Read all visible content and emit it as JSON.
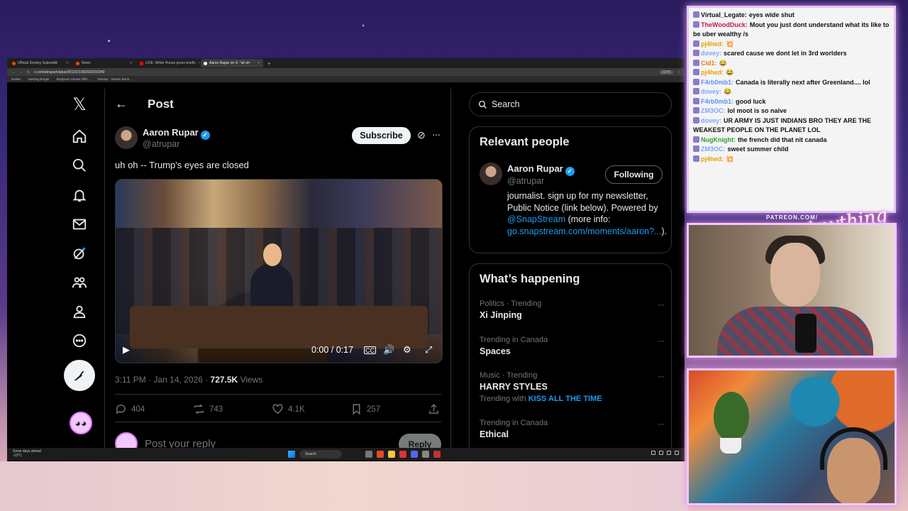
{
  "browser": {
    "tabs": [
      {
        "label": "Official Destiny Subreddit"
      },
      {
        "label": "News"
      },
      {
        "label": "LIVE: White House press briefin"
      },
      {
        "label": "Aaron Rupar on X: \"uh oh"
      }
    ],
    "url": "x.com/atrupar/status/2011531582692016349",
    "zoom": "210%",
    "bookmarks": [
      "Dailies",
      "Nothing Burger",
      "Bodycam Shows Offic...",
      "Destiny - Steven Bonn..."
    ]
  },
  "header": {
    "title": "Post"
  },
  "post": {
    "author_name": "Aaron Rupar",
    "author_handle": "@atrupar",
    "subscribe_label": "Subscribe",
    "text": "uh oh  -- Trump's eyes are closed",
    "video_time": "0:00 / 0:17",
    "timestamp": "3:11 PM · Jan 14, 2026 · ",
    "views_count": "727.5K",
    "views_label": " Views",
    "replies": "404",
    "reposts": "743",
    "likes": "4.1K",
    "bookmarks": "257",
    "reply_placeholder": "Post your reply",
    "reply_button": "Reply"
  },
  "sidebar": {
    "search_placeholder": "Search",
    "relevant_title": "Relevant people",
    "person": {
      "name": "Aaron Rupar",
      "handle": "@atrupar",
      "follow_label": "Following",
      "bio_1": "journalist. sign up for my newsletter, Public Notice (link below). Powered by ",
      "bio_mention": "@SnapStream",
      "bio_2": " (more info: ",
      "bio_link": "go.snapstream.com/moments/aaron?...",
      "bio_3": ")."
    },
    "happening_title": "What’s happening",
    "trends": [
      {
        "category": "Politics · Trending",
        "name": "Xi Jinping"
      },
      {
        "category": "Trending in Canada",
        "name": "Spaces"
      },
      {
        "category": "Music · Trending",
        "name": "HARRY STYLES",
        "sub_prefix": "Trending with ",
        "sub_link": "KISS ALL THE TIME"
      },
      {
        "category": "Trending in Canada",
        "name": "Ethical"
      }
    ]
  },
  "taskbar": {
    "weather_1": "Snow days ahead",
    "weather_2": "-13°C",
    "search": "Search"
  },
  "chat": {
    "messages": [
      {
        "user": "Virtual_Legate:",
        "text": "eyes wide shut",
        "color": "#111111"
      },
      {
        "user": "TheWoodDuck:",
        "text": "Mout you just dont understand what its like to be uber wealthy /s",
        "color": "#c2185b"
      },
      {
        "user": "pj4hed:",
        "text": "💥",
        "color": "#e6a100"
      },
      {
        "user": "dovey:",
        "text": "scared cause we dont let in 3rd worlders",
        "color": "#7fa3ff"
      },
      {
        "user": "Cid1:",
        "text": "😂",
        "color": "#e67e00"
      },
      {
        "user": "pj4hed:",
        "text": "😂",
        "color": "#e6a100"
      },
      {
        "user": "F4rb0mb1:",
        "text": "Canada is literally next after Greenland.... lol",
        "color": "#5c8dff"
      },
      {
        "user": "dovey:",
        "text": "😂",
        "color": "#7fa3ff"
      },
      {
        "user": "F4rb0mb1:",
        "text": "good luck",
        "color": "#5c8dff"
      },
      {
        "user": "ZM3OC:",
        "text": "lol moot is so naive",
        "color": "#7fa3ff"
      },
      {
        "user": "dovey:",
        "text": "UR ARMY IS JUST INDIANS BRO THEY ARE THE WEAKEST PEOPLE ON THE PLANET LOL",
        "color": "#7fa3ff"
      },
      {
        "user": "NugKnight:",
        "text": "the french did that nit canada",
        "color": "#2e9e2e"
      },
      {
        "user": "ZM3OC:",
        "text": "sweet summer child",
        "color": "#7fa3ff"
      },
      {
        "user": "pj4hed:",
        "text": "💥",
        "color": "#e6a100"
      }
    ]
  },
  "overlay": {
    "patreon": "PATREON.COM/",
    "signature": "Anything else?"
  }
}
